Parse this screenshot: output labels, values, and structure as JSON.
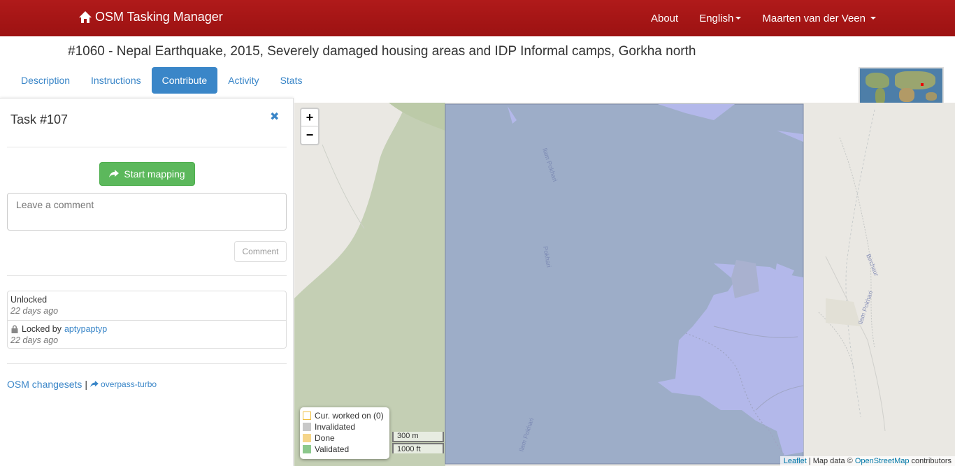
{
  "navbar": {
    "brand": "OSM Tasking Manager",
    "brand_icon": "home-icon",
    "about": "About",
    "language": "English",
    "user": "Maarten van der Veen"
  },
  "project": {
    "title": "#1060 - Nepal Earthquake, 2015, Severely damaged housing areas and IDP Informal camps, Gorkha north"
  },
  "tabs": [
    {
      "label": "Description",
      "active": false
    },
    {
      "label": "Instructions",
      "active": false
    },
    {
      "label": "Contribute",
      "active": true
    },
    {
      "label": "Activity",
      "active": false
    },
    {
      "label": "Stats",
      "active": false
    }
  ],
  "task": {
    "title": "Task #107",
    "start_mapping": "Start mapping",
    "comment_placeholder": "Leave a comment",
    "comment_button": "Comment",
    "history": [
      {
        "action": "Unlocked",
        "user": "",
        "time": "22 days ago"
      },
      {
        "action": "Locked by",
        "user": "aptypaptyp",
        "time": "22 days ago"
      }
    ],
    "osm_changesets": "OSM changesets",
    "separator": "|",
    "overpass": "overpass-turbo"
  },
  "map": {
    "zoom_in": "+",
    "zoom_out": "−",
    "legend": [
      {
        "label": "Cur. worked on (0)",
        "color": "#ffffff",
        "border": "#f0c040"
      },
      {
        "label": "Invalidated",
        "color": "#c8c8c8",
        "border": "#c8c8c8"
      },
      {
        "label": "Done",
        "color": "#f5d58a",
        "border": "#f5d58a"
      },
      {
        "label": "Validated",
        "color": "#8cc88c",
        "border": "#8cc88c"
      }
    ],
    "scale_metric": "300 m",
    "scale_imperial": "1000 ft",
    "labels": [
      "Ilam Pokhari",
      "Pokhari",
      "Ilam Pokhari",
      "Birchaur",
      "Ilam Pokhari"
    ],
    "attribution": {
      "leaflet": "Leaflet",
      "separator": " | Map data © ",
      "osm": "OpenStreetMap",
      "suffix": " contributors"
    }
  },
  "colors": {
    "navbar": "#a8171a",
    "accent": "#3a86c8",
    "success": "#5cb85c",
    "task_fill": "#9dadc8",
    "lake": "#b3b8ea"
  }
}
